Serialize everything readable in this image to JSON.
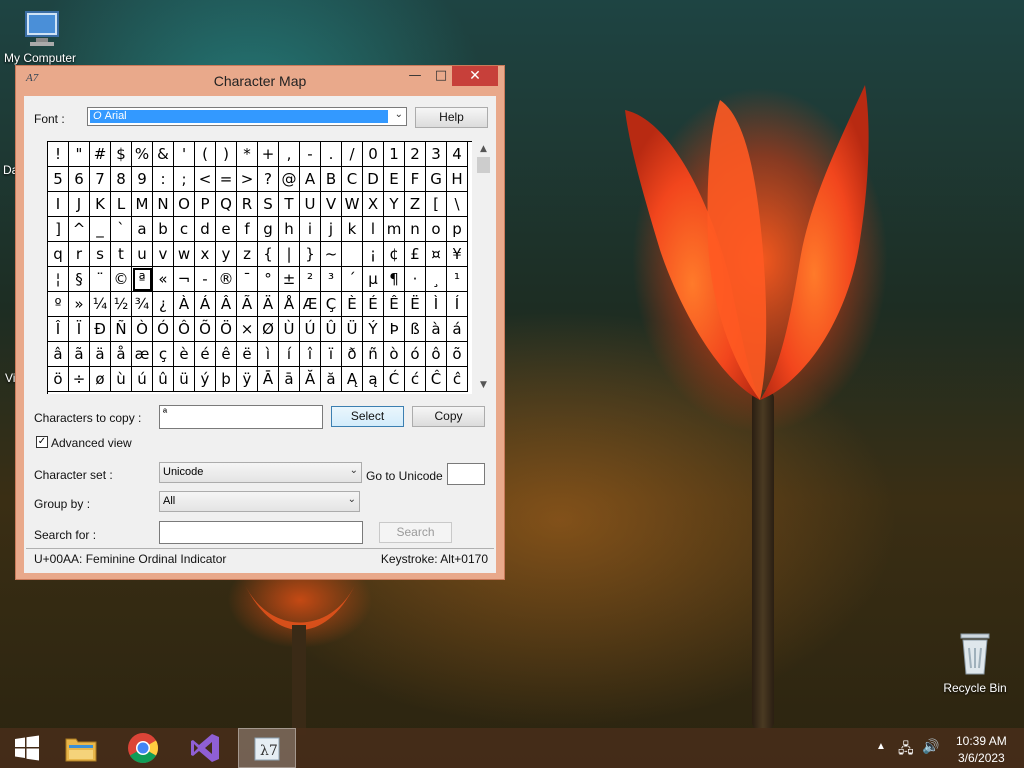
{
  "desktop": {
    "icons": [
      {
        "label": "My Computer"
      },
      {
        "label": "Recycle Bin"
      }
    ],
    "edge_labels": [
      "Da",
      "Vi"
    ]
  },
  "window": {
    "title": "Character Map",
    "title_icon": "charmap-icon",
    "controls": {
      "minimize": "minimize-icon",
      "maximize": "maximize-icon",
      "close": "close-icon"
    },
    "font_label": "Font :",
    "font_value": "Arial",
    "help_button": "Help",
    "characters": [
      [
        "!",
        "\"",
        "#",
        "$",
        "%",
        "&",
        "'",
        "(",
        ")",
        "*",
        "+",
        ",",
        "-",
        ".",
        "/",
        "0",
        "1",
        "2",
        "3",
        "4"
      ],
      [
        "5",
        "6",
        "7",
        "8",
        "9",
        ":",
        ";",
        "<",
        "=",
        ">",
        "?",
        "@",
        "A",
        "B",
        "C",
        "D",
        "E",
        "F",
        "G",
        "H"
      ],
      [
        "I",
        "J",
        "K",
        "L",
        "M",
        "N",
        "O",
        "P",
        "Q",
        "R",
        "S",
        "T",
        "U",
        "V",
        "W",
        "X",
        "Y",
        "Z",
        "[",
        "\\"
      ],
      [
        "]",
        "^",
        "_",
        "`",
        "a",
        "b",
        "c",
        "d",
        "e",
        "f",
        "g",
        "h",
        "i",
        "j",
        "k",
        "l",
        "m",
        "n",
        "o",
        "p"
      ],
      [
        "q",
        "r",
        "s",
        "t",
        "u",
        "v",
        "w",
        "x",
        "y",
        "z",
        "{",
        "|",
        "}",
        "~",
        " ",
        "¡",
        "¢",
        "£",
        "¤",
        "¥"
      ],
      [
        "¦",
        "§",
        "¨",
        "©",
        "ª",
        "«",
        "¬",
        "-",
        "®",
        "¯",
        "°",
        "±",
        "²",
        "³",
        "´",
        "µ",
        "¶",
        "·",
        "¸",
        "¹"
      ],
      [
        "º",
        "»",
        "¼",
        "½",
        "¾",
        "¿",
        "À",
        "Á",
        "Â",
        "Ã",
        "Ä",
        "Å",
        "Æ",
        "Ç",
        "È",
        "É",
        "Ê",
        "Ë",
        "Ì",
        "Í"
      ],
      [
        "Î",
        "Ï",
        "Ð",
        "Ñ",
        "Ò",
        "Ó",
        "Ô",
        "Õ",
        "Ö",
        "×",
        "Ø",
        "Ù",
        "Ú",
        "Û",
        "Ü",
        "Ý",
        "Þ",
        "ß",
        "à",
        "á"
      ],
      [
        "â",
        "ã",
        "ä",
        "å",
        "æ",
        "ç",
        "è",
        "é",
        "ê",
        "ë",
        "ì",
        "í",
        "î",
        "ï",
        "ð",
        "ñ",
        "ò",
        "ó",
        "ô",
        "õ"
      ],
      [
        "ö",
        "÷",
        "ø",
        "ù",
        "ú",
        "û",
        "ü",
        "ý",
        "þ",
        "ÿ",
        "Ā",
        "ā",
        "Ă",
        "ă",
        "Ą",
        "ą",
        "Ć",
        "ć",
        "Ĉ",
        "ĉ"
      ]
    ],
    "selected_char": "ª",
    "chars_to_copy_label": "Characters to copy :",
    "chars_to_copy_value": "ª",
    "select_button": "Select",
    "copy_button": "Copy",
    "advanced_view_label": "Advanced view",
    "advanced_view_checked": true,
    "character_set_label": "Character set :",
    "character_set_value": "Unicode",
    "go_to_unicode_label": "Go to Unicode :",
    "go_to_unicode_value": "",
    "group_by_label": "Group by :",
    "group_by_value": "All",
    "search_for_label": "Search for :",
    "search_for_value": "",
    "search_button": "Search",
    "status_left": "U+00AA: Feminine Ordinal Indicator",
    "status_right": "Keystroke: Alt+0170"
  },
  "taskbar": {
    "items": [
      {
        "name": "start-icon"
      },
      {
        "name": "file-explorer-icon"
      },
      {
        "name": "chrome-icon"
      },
      {
        "name": "visual-studio-icon"
      },
      {
        "name": "charmap-taskbar-icon",
        "active": true
      }
    ],
    "time": "10:39 AM",
    "date": "3/6/2023"
  }
}
